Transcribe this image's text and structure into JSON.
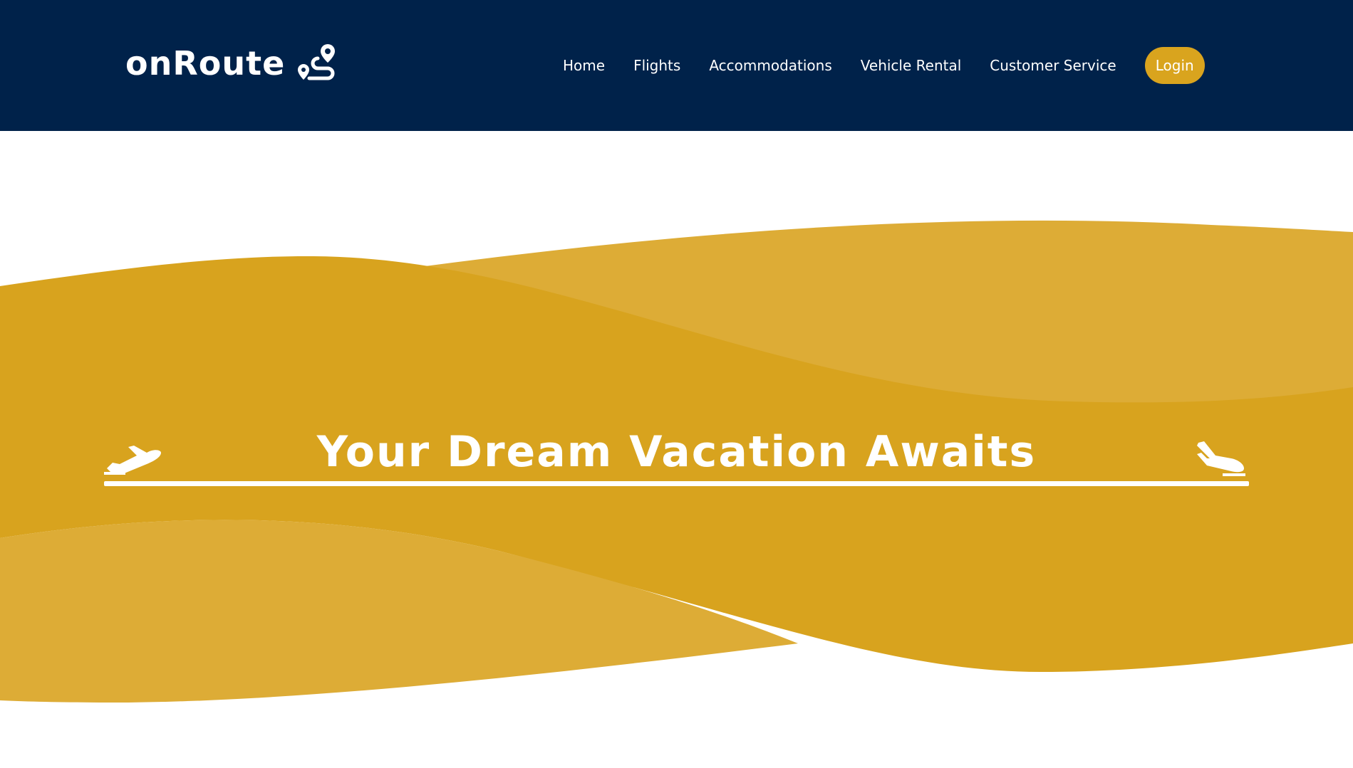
{
  "brand": {
    "name": "onRoute",
    "icon": "route-pin-icon"
  },
  "nav": {
    "items": [
      {
        "label": "Home"
      },
      {
        "label": "Flights"
      },
      {
        "label": "Accommodations"
      },
      {
        "label": "Vehicle Rental"
      },
      {
        "label": "Customer Service"
      }
    ],
    "login_label": "Login"
  },
  "hero": {
    "title": "Your Dream Vacation Awaits",
    "left_icon": "plane-takeoff-icon",
    "right_icon": "plane-landing-icon"
  },
  "colors": {
    "header_bg": "#00224a",
    "accent": "#d9a41e",
    "wave_dark": "#d8a31e",
    "wave_light": "#ddac36",
    "text_light": "#ffffff"
  }
}
